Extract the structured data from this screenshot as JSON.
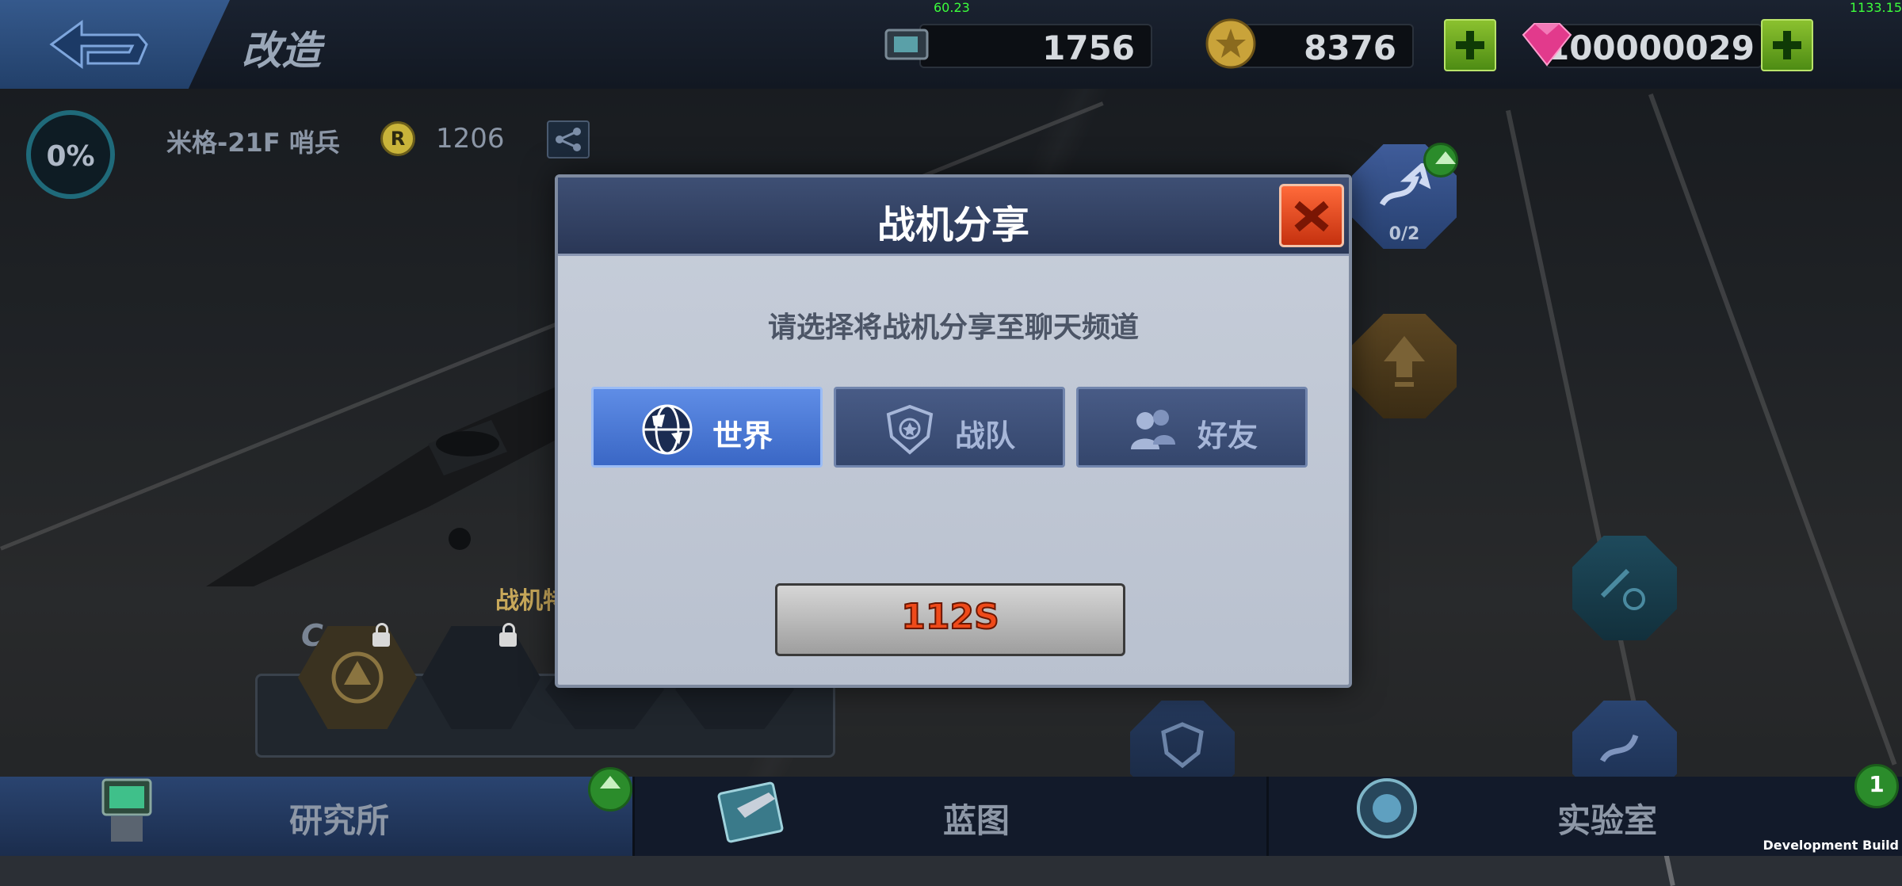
{
  "topbar": {
    "title": "改造",
    "fps": "60.23",
    "fps_right": "1133.15",
    "resources": [
      {
        "icon": "chip-icon",
        "value": "1756"
      },
      {
        "icon": "gold-coin-icon",
        "value": "8376"
      },
      {
        "icon": "diamond-icon",
        "value": "100000029"
      }
    ]
  },
  "plane": {
    "progress": "0%",
    "name": "米格-21F 哨兵",
    "rating": "1206"
  },
  "nodes": {
    "upgrade_count": "0/2"
  },
  "slots": {
    "label": "战机特",
    "slot_letter": "C"
  },
  "dialog": {
    "title": "战机分享",
    "prompt": "请选择将战机分享至聊天频道",
    "channels": [
      {
        "label": "世界",
        "icon": "globe-icon",
        "selected": true
      },
      {
        "label": "战队",
        "icon": "shield-badge-icon",
        "selected": false
      },
      {
        "label": "好友",
        "icon": "friends-icon",
        "selected": false
      }
    ],
    "timer": "112S"
  },
  "bottomnav": {
    "tabs": [
      {
        "label": "研究所",
        "icon": "research-terminal-icon",
        "active": true
      },
      {
        "label": "蓝图",
        "icon": "blueprint-icon",
        "active": false
      },
      {
        "label": "实验室",
        "icon": "lab-icon",
        "active": false
      }
    ],
    "lab_badge": "1"
  },
  "build_label": "Development Build",
  "colors": {
    "accent_blue": "#3a67c5",
    "close_red": "#c5310f",
    "timer_orange": "#ef4a1a",
    "plus_green": "#4e8c14"
  }
}
